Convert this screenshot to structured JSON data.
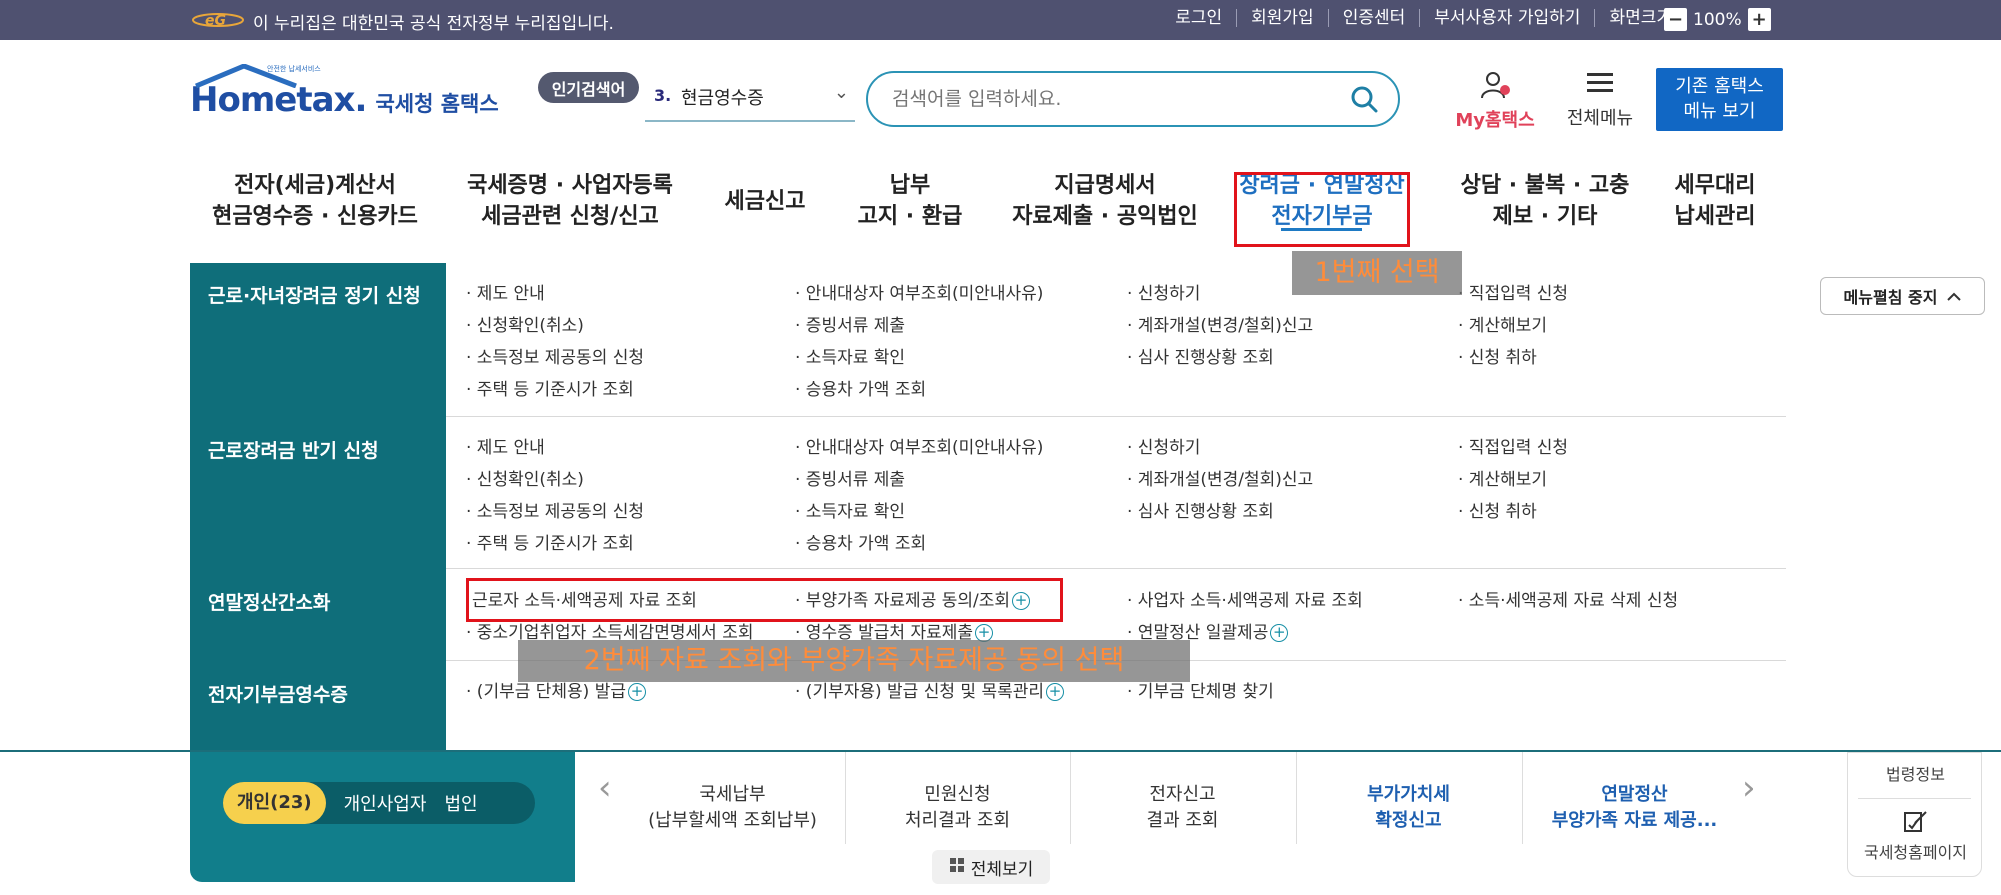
{
  "gov_bar": {
    "notice": "이 누리집은 대한민국 공식 전자정부 누리집입니다.",
    "links": [
      "로그인",
      "회원가입",
      "인증센터",
      "부서사용자 가입하기",
      "화면크기"
    ],
    "zoom_minus": "−",
    "zoom_value": "100%",
    "zoom_plus": "+"
  },
  "brand": {
    "logo_text_home": "Hom",
    "logo_text_e": "e",
    "logo_text_tax": "tax.",
    "logo_tagline": "국세청 홈택스",
    "logo_small": "안전한 납세서비스"
  },
  "header": {
    "popular_badge": "인기검색어",
    "popular_num": "3.",
    "popular_term": "현금영수증",
    "search_placeholder": "검색어를 입력하세요.",
    "my_home": "My홈택스",
    "all_menu": "전체메뉴",
    "legacy_line1": "기존 홈택스",
    "legacy_line2": "메뉴 보기"
  },
  "nav": [
    {
      "l1": "전자(세금)계산서",
      "l2": "현금영수증 · 신용카드"
    },
    {
      "l1": "국세증명 · 사업자등록",
      "l2": "세금관련 신청/신고"
    },
    {
      "l1": "세금신고",
      "l2": ""
    },
    {
      "l1": "납부",
      "l2": "고지 · 환급"
    },
    {
      "l1": "지급명세서",
      "l2": "자료제출 · 공익법인"
    },
    {
      "l1": "장려금 · 연말정산",
      "l2": "전자기부금"
    },
    {
      "l1": "상담 · 불복 · 고충",
      "l2": "제보 · 기타"
    },
    {
      "l1": "세무대리",
      "l2": "납세관리"
    }
  ],
  "annotations": {
    "note1": "1번째 선택",
    "note2": "2번째 자료 조회와 부양가족 자료제공 동의 선택"
  },
  "mega_menu": {
    "stop_button": "메뉴펼침 중지",
    "sections": [
      {
        "title": "근로·자녀장려금 정기 신청",
        "cols": [
          [
            "· 제도 안내",
            "· 신청확인(취소)",
            "· 소득정보 제공동의 신청",
            "· 주택 등 기준시가 조회"
          ],
          [
            "· 안내대상자 여부조회(미안내사유)",
            "· 증빙서류 제출",
            "· 소득자료 확인",
            "· 승용차 가액 조회"
          ],
          [
            "· 신청하기",
            "· 계좌개설(변경/철회)신고",
            "· 심사 진행상황 조회"
          ],
          [
            "· 직접입력 신청",
            "· 계산해보기",
            "· 신청 취하"
          ]
        ]
      },
      {
        "title": "근로장려금 반기 신청",
        "cols": [
          [
            "· 제도 안내",
            "· 신청확인(취소)",
            "· 소득정보 제공동의 신청",
            "· 주택 등 기준시가 조회"
          ],
          [
            "· 안내대상자 여부조회(미안내사유)",
            "· 증빙서류 제출",
            "· 소득자료 확인",
            "· 승용차 가액 조회"
          ],
          [
            "· 신청하기",
            "· 계좌개설(변경/철회)신고",
            "· 심사 진행상황 조회"
          ],
          [
            "· 직접입력 신청",
            "· 계산해보기",
            "· 신청 취하"
          ]
        ]
      },
      {
        "title": "연말정산간소화",
        "cols": [
          [
            "근로자 소득·세액공제 자료 조회",
            "· 중소기업취업자 소득세감면명세서 조회"
          ],
          [
            "· 부양가족 자료제공 동의/조회",
            "· 영수증 발급처 자료제출"
          ],
          [
            "· 사업자 소득·세액공제 자료 조회",
            "· 연말정산 일괄제공"
          ],
          [
            "· 소득·세액공제 자료 삭제 신청"
          ]
        ]
      },
      {
        "title": "전자기부금영수증",
        "cols": [
          [
            "· (기부금 단체용) 발급"
          ],
          [
            "· (기부자용) 발급 신청 및 목록관리"
          ],
          [
            "· 기부금 단체명 찾기"
          ],
          []
        ]
      }
    ]
  },
  "lower": {
    "segments": [
      "개인(23)",
      "개인사업자",
      "법인"
    ],
    "quick_links": [
      {
        "l1": "국세납부",
        "l2": "(납부할세액 조회납부)"
      },
      {
        "l1": "민원신청",
        "l2": "처리결과 조회"
      },
      {
        "l1": "전자신고",
        "l2": "결과 조회"
      },
      {
        "l1": "부가가치세",
        "l2": "확정신고"
      },
      {
        "l1": "연말정산",
        "l2": "부양가족 자료 제공..."
      }
    ],
    "view_all": "전체보기",
    "side_1": "법령정보",
    "side_2": "국세청홈페이지"
  },
  "colors": {
    "gov_bar": "#4f5170",
    "brand_blue": "#1f4ea3",
    "teal": "#0f6e7a",
    "highlight_red": "#e1131b",
    "legacy_blue": "#1167c4",
    "annotation_orange": "#ff8c3a",
    "segment_yellow": "#f6d04d"
  }
}
